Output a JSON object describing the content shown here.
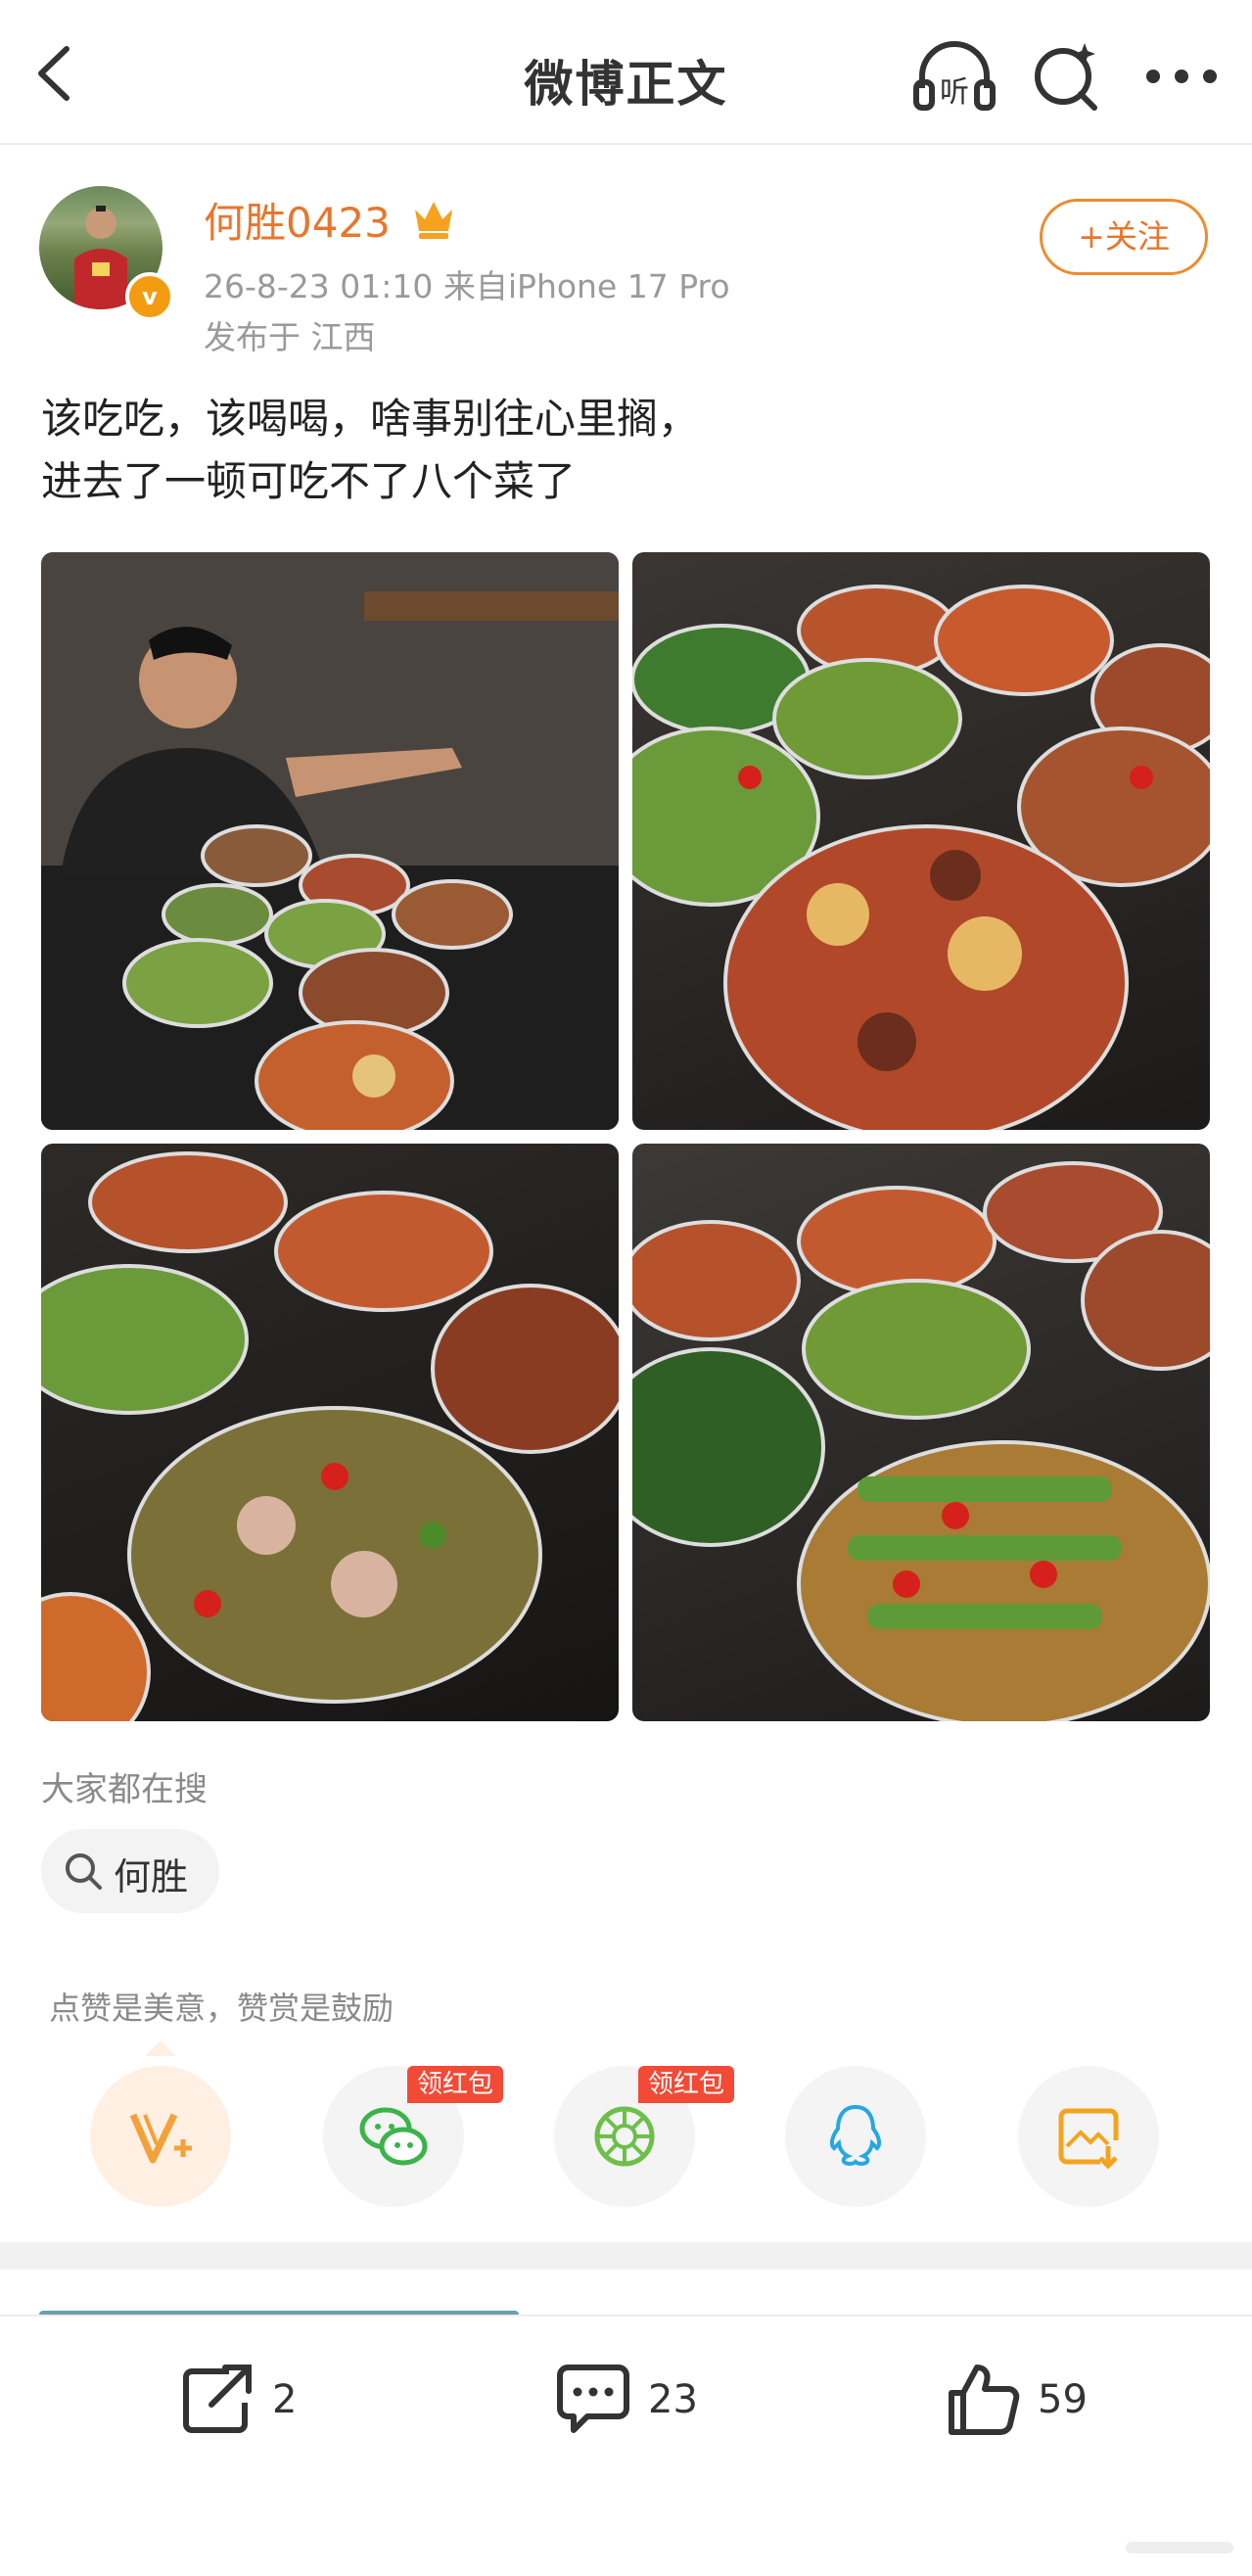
{
  "nav": {
    "title": "微博正文",
    "listen_label": "听"
  },
  "author": {
    "name": "何胜0423",
    "verified_badge": "v",
    "meta_time_source": "26-8-23 01:10  来自iPhone 17 Pro",
    "meta_location": "发布于 江西",
    "follow_label": "+关注"
  },
  "post": {
    "line1": "该吃吃，该喝喝，啥事别往心里搁，",
    "line2": "进去了一顿可吃不了八个菜了"
  },
  "trending": {
    "label": "大家都在搜",
    "chip": "何胜"
  },
  "reward": {
    "note": "点赞是美意，赞赏是鼓励",
    "red_packet_tag": "领红包",
    "red_packet_tag2": "领红包"
  },
  "actions": {
    "repost_count": "2",
    "comment_count": "23",
    "like_count": "59"
  },
  "colors": {
    "accent_orange": "#e8762c",
    "wechat_green": "#3bb44a",
    "moments_green": "#6cc04a",
    "qq_blue": "#27a6e5",
    "save_orange": "#f3a41f",
    "red_tag": "#f24a36"
  },
  "icons": [
    "back-icon",
    "listen-icon",
    "search-ai-icon",
    "more-icon",
    "crown-icon",
    "search-icon",
    "weibo-v-plus-icon",
    "wechat-icon",
    "moments-icon",
    "qq-icon",
    "save-image-icon",
    "repost-icon",
    "comment-icon",
    "like-icon"
  ]
}
